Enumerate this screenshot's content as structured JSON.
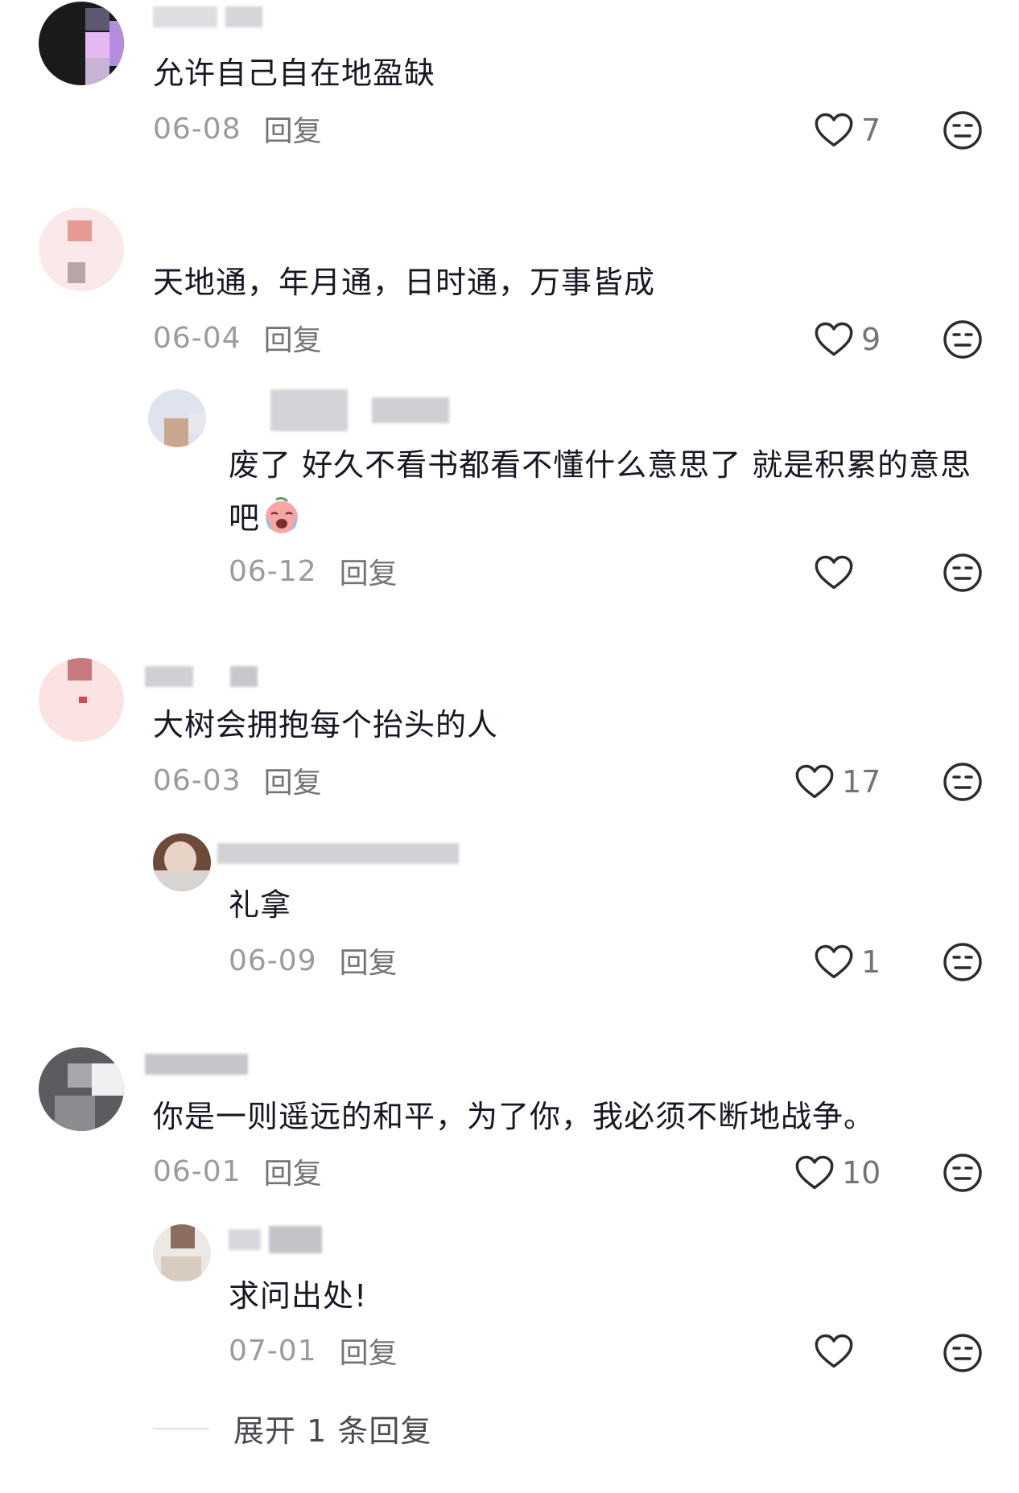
{
  "comments": [
    {
      "text": "允许自己自在地盈缺",
      "date": "06-08",
      "reply_label": "回复",
      "likes": "7"
    },
    {
      "text": "天地通，年月通，日时通，万事皆成",
      "date": "06-04",
      "reply_label": "回复",
      "likes": "9",
      "reply": {
        "text": "废了 好久不看书都看不懂什么意思了 就是积累的意思吧",
        "date": "06-12",
        "reply_label": "回复",
        "likes": ""
      }
    },
    {
      "text": "大树会拥抱每个抬头的人",
      "date": "06-03",
      "reply_label": "回复",
      "likes": "17",
      "reply": {
        "text": "礼拿",
        "date": "06-09",
        "reply_label": "回复",
        "likes": "1"
      }
    },
    {
      "text": "你是一则遥远的和平，为了你，我必须不断地战争。",
      "date": "06-01",
      "reply_label": "回复",
      "likes": "10",
      "reply": {
        "text": "求问出处!",
        "date": "07-01",
        "reply_label": "回复",
        "likes": ""
      }
    }
  ],
  "expand_label": "展开 1 条回复",
  "colors": {
    "text": "#161823",
    "meta": "#9a9aa0",
    "icon": "#2b2b33"
  }
}
